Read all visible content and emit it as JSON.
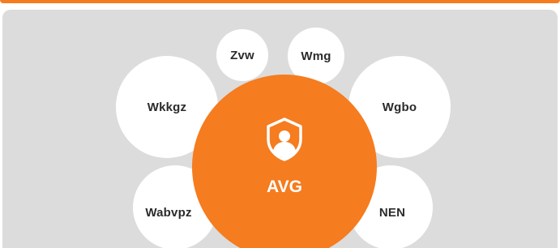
{
  "diagram": {
    "center": {
      "label": "AVG",
      "icon": "shield-user-icon",
      "color": "#f57c1f"
    },
    "nodes": [
      {
        "id": "zvw",
        "label": "Zvw"
      },
      {
        "id": "wmg",
        "label": "Wmg"
      },
      {
        "id": "wkkgz",
        "label": "Wkkgz"
      },
      {
        "id": "wgbo",
        "label": "Wgbo"
      },
      {
        "id": "wabvpz",
        "label": "Wabvpz"
      },
      {
        "id": "nen",
        "label": "NEN"
      }
    ]
  },
  "colors": {
    "accent": "#f57c1f",
    "panel_background": "#dcdcdc",
    "bubble_background": "#ffffff"
  }
}
